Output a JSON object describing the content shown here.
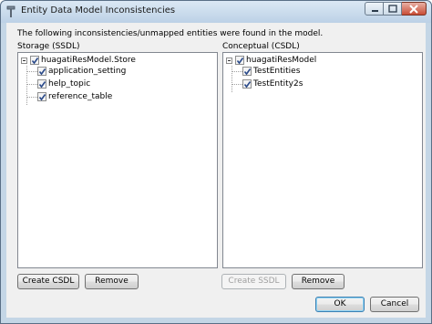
{
  "window": {
    "title": "Entity Data Model Inconsistencies"
  },
  "message": "The following inconsistencies/unmapped entities were found in the model.",
  "storage": {
    "label": "Storage (SSDL)",
    "root": {
      "label": "huagatiResModel.Store",
      "checked": true,
      "expanded": true
    },
    "children": [
      {
        "label": "application_setting",
        "checked": true
      },
      {
        "label": "help_topic",
        "checked": true
      },
      {
        "label": "reference_table",
        "checked": true
      }
    ],
    "create_button": "Create CSDL",
    "remove_button": "Remove"
  },
  "conceptual": {
    "label": "Conceptual (CSDL)",
    "root": {
      "label": "huagatiResModel",
      "checked": true,
      "expanded": true
    },
    "children": [
      {
        "label": "TestEntities",
        "checked": true
      },
      {
        "label": "TestEntity2s",
        "checked": true
      }
    ],
    "create_button": "Create SSDL",
    "remove_button": "Remove"
  },
  "footer": {
    "ok_button": "OK",
    "cancel_button": "Cancel"
  },
  "icons": {
    "app": "pin-icon",
    "minimize": "minimize-icon",
    "maximize": "maximize-icon",
    "close": "close-icon",
    "check": "check-icon"
  }
}
